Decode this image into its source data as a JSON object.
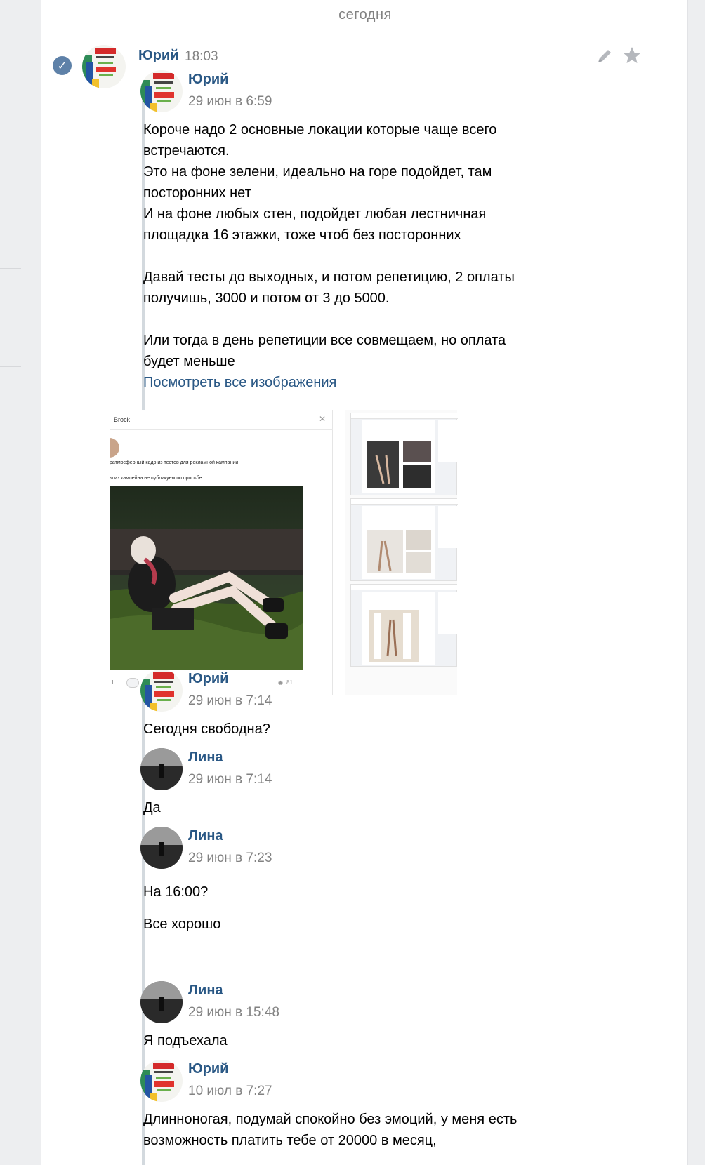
{
  "date_separator": "сегодня",
  "message": {
    "author": "Юрий",
    "time": "18:03"
  },
  "forwarded": [
    {
      "author": "Юрий",
      "date": "29 июн в 6:59",
      "lines": [
        "Короче надо 2 основные локации которые чаще всего",
        "встречаются.",
        "Это на фоне зелени, идеально на горе подойдет, там",
        "посторонних нет",
        "И на фоне любых стен, подойдет любая лестничная",
        "площадка 16 этажки, тоже чтоб без посторонних",
        "",
        "Давай тесты до выходных, и потом репетицию, 2 оплаты",
        "получишь, 3000 и потом от 3 до 5000.",
        "",
        "Или тогда в день репетиции все совмещаем, но оплата",
        "будет меньше"
      ],
      "link": "Посмотреть все изображения"
    },
    {
      "author": "Юрий",
      "date": "29 июн в 7:14",
      "lines": [
        "Сегодня свободна?"
      ]
    },
    {
      "author": "Лина",
      "date": "29 июн в 7:14",
      "lines": [
        "Да"
      ]
    },
    {
      "author": "Лина",
      "date": "29 июн в 7:23",
      "lines": [
        "На 16:00?",
        "",
        "Все хорошо"
      ]
    },
    {
      "author": "Лина",
      "date": "29 июн в 15:48",
      "lines": [
        "Я подъехала"
      ]
    },
    {
      "author": "Юрий",
      "date": "10 июл в 7:27",
      "lines": [
        "Длинноногая, подумай спокойно без эмоций, у меня есть",
        "возможность платить тебе от 20000 в месяц,"
      ]
    }
  ],
  "attachment_left": {
    "title": "Brock",
    "line1": "ратмосферный кадр из тестов для рекламной кампании",
    "line2": "ы из кампейна не публикуем по просьбе ...",
    "likes": "1",
    "views": "81"
  },
  "icons": {
    "verified": "check-icon",
    "edit": "pencil-icon",
    "favorite": "star-icon"
  },
  "colors": {
    "link": "#2a5885",
    "meta": "#828282",
    "background": "#edeef0"
  }
}
